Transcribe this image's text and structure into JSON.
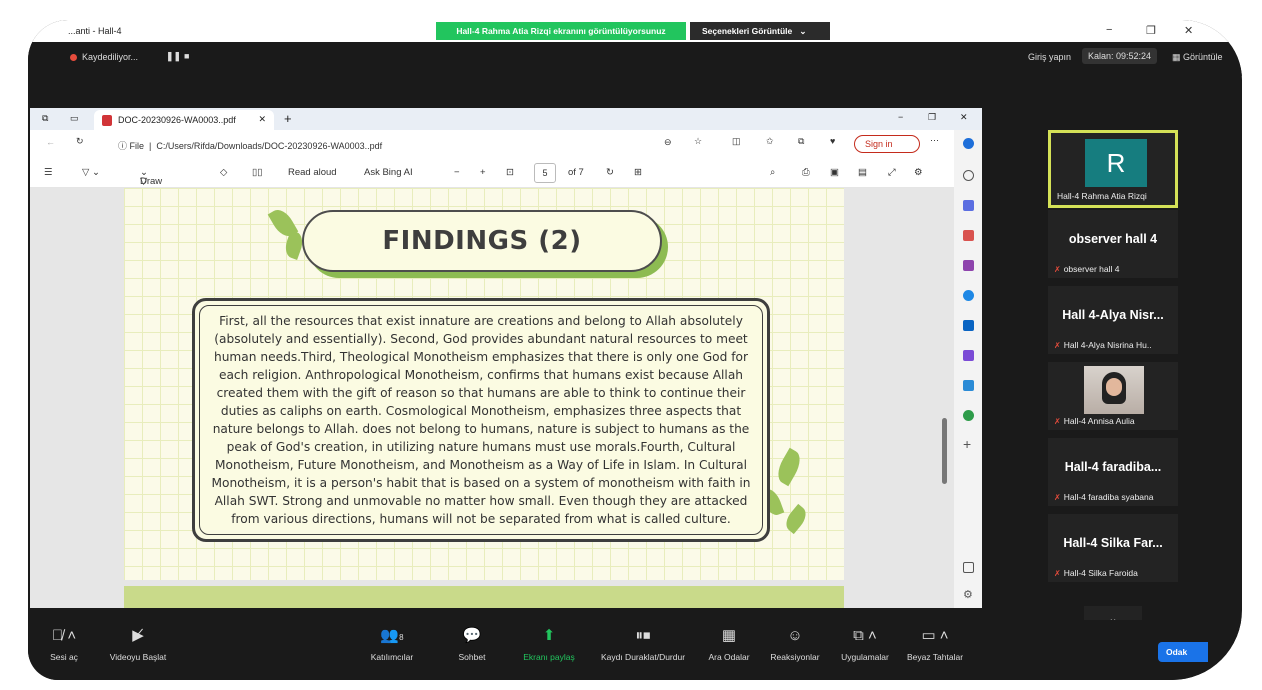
{
  "zoom_window": {
    "title": "...anti - Hall-4",
    "share_banner": "Hall-4 Rahma Atia Rizqi ekranını görüntülüyorsunuz",
    "options_button": "Seçenekleri Görüntüle",
    "recording_label": "Kaydediliyor...",
    "sign_in": "Giriş yapın",
    "remaining_time": "Kalan: 09:52:24",
    "view_button": "Görüntüle"
  },
  "browser": {
    "tab_title": "DOC-20230926-WA0003..pdf",
    "url_prefix": "File",
    "url": "C:/Users/Rifda/Downloads/DOC-20230926-WA0003..pdf",
    "sign_in": "Sign in",
    "pdf_toolbar": {
      "draw": "Draw",
      "read_aloud": "Read aloud",
      "ask_bing": "Ask Bing AI",
      "page_current": "5",
      "page_total": "of 7"
    }
  },
  "document": {
    "title": "FINDINGS (2)",
    "body": "First, all the resources that exist innature are creations and belong to Allah absolutely (absolutely and essentially). Second, God provides abundant natural resources to meet human needs.Third, Theological Monotheism emphasizes that there is only one God for each religion. Anthropological Monotheism, confirms that humans exist because Allah created them with the gift of reason so that humans are able to think to continue their duties as caliphs on earth. Cosmological Monotheism, emphasizes three aspects that nature belongs to Allah. does not belong to humans, nature is subject to humans as the peak of God's creation, in utilizing nature humans must use morals.Fourth, Cultural Monotheism, Future Monotheism, and Monotheism as a Way of Life in Islam. In Cultural Monotheism, it is a person's habit that is based on a system of monotheism with faith in Allah SWT. Strong and unmovable no matter how small. Even though they are attacked from various directions, humans will not be separated from what is called culture."
  },
  "participants": [
    {
      "avatar_letter": "R",
      "label": "Hall-4 Rahma Atia Rizqi"
    },
    {
      "display": "observer hall 4",
      "label": "observer hall 4"
    },
    {
      "display": "Hall 4-Alya Nisr...",
      "label": "Hall 4-Alya Nisrina Hu.."
    },
    {
      "label": "Hall-4 Annisa Aulia"
    },
    {
      "display": "Hall-4 faradiba...",
      "label": "Hall-4 faradiba syabana"
    },
    {
      "display": "Hall-4 Silka Far...",
      "label": "Hall-4 Silka Faroida"
    }
  ],
  "toolbar": {
    "audio": "Sesi aç",
    "video": "Videoyu Başlat",
    "participants": "Katılımcılar",
    "participant_count": "8",
    "chat": "Sohbet",
    "share": "Ekranı paylaş",
    "record": "Kaydı Duraklat/Durdur",
    "breakout": "Ara Odalar",
    "reactions": "Reaksiyonlar",
    "apps": "Uygulamalar",
    "whiteboard": "Beyaz Tahtalar",
    "focus": "Odak"
  },
  "colors": {
    "share_green": "#22c55e",
    "speaker_border": "#d4e157",
    "avatar_teal": "#167d7f",
    "leaf_green": "#9bc25a"
  }
}
